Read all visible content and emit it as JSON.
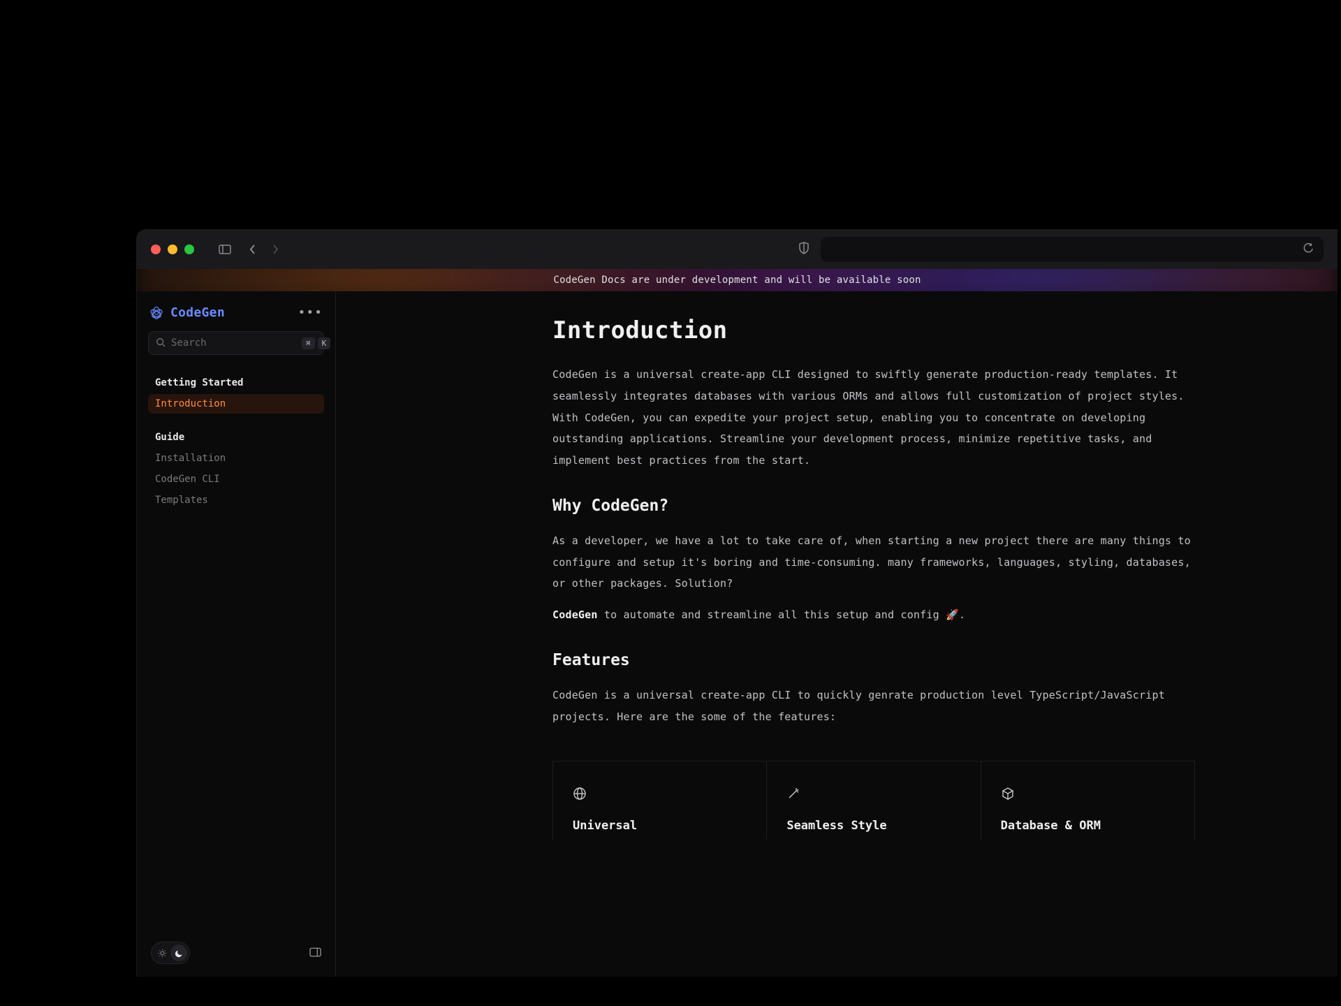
{
  "banner": {
    "text": "CodeGen Docs are under development and will be available soon"
  },
  "brand": {
    "name": "CodeGen"
  },
  "search": {
    "placeholder": "Search",
    "shortcut1": "⌘",
    "shortcut2": "K"
  },
  "nav": {
    "sections": [
      {
        "heading": "Getting Started",
        "items": [
          {
            "label": "Introduction",
            "active": true
          }
        ]
      },
      {
        "heading": "Guide",
        "items": [
          {
            "label": "Installation",
            "active": false
          },
          {
            "label": "CodeGen CLI",
            "active": false
          },
          {
            "label": "Templates",
            "active": false
          }
        ]
      }
    ]
  },
  "page": {
    "h1": "Introduction",
    "intro": "CodeGen is a universal create-app CLI designed to swiftly generate production-ready templates. It seamlessly integrates databases with various ORMs and allows full customization of project styles. With CodeGen, you can expedite your project setup, enabling you to concentrate on developing outstanding applications. Streamline your development process, minimize repetitive tasks, and implement best practices from the start.",
    "why_h": "Why CodeGen?",
    "why_p1": "As a developer, we have a lot to take care of, when starting a new project there are many things to configure and setup it's boring and time-consuming. many frameworks, languages, styling, databases, or other packages. Solution?",
    "why_p2_strong": "CodeGen",
    "why_p2_rest": " to automate and streamline all this setup and config 🚀.",
    "features_h": "Features",
    "features_intro": "CodeGen is a universal create-app CLI to quickly genrate production level TypeScript/JavaScript projects. Here are the some of the features:",
    "cards": [
      {
        "title": "Universal"
      },
      {
        "title": "Seamless Style"
      },
      {
        "title": "Database & ORM"
      }
    ]
  }
}
